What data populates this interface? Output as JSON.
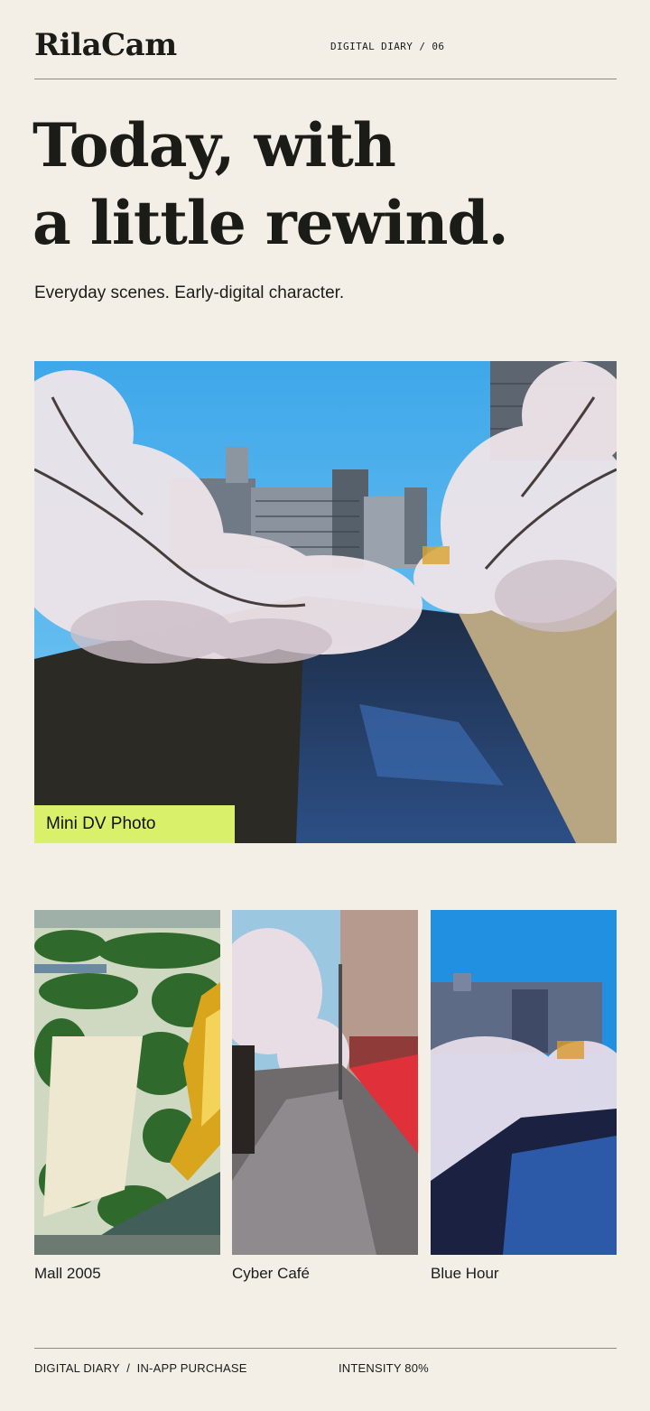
{
  "header": {
    "logo": "RilaCam",
    "issue": "DIGITAL DIARY / 06"
  },
  "hero": {
    "headline_line1": "Today, with",
    "headline_line2": "a little rewind.",
    "subtitle": "Everyday scenes. Early-digital character."
  },
  "feature": {
    "badge": "Mini DV Photo"
  },
  "gallery": {
    "items": [
      {
        "caption": "Mall 2005"
      },
      {
        "caption": "Cyber Café"
      },
      {
        "caption": "Blue Hour"
      }
    ]
  },
  "footer": {
    "left": "DIGITAL DIARY  /  IN-APP PURCHASE",
    "right": "INTENSITY 80%"
  },
  "colors": {
    "background": "#f3efe6",
    "accent_badge": "#d8f06a",
    "text": "#1b1b18"
  }
}
